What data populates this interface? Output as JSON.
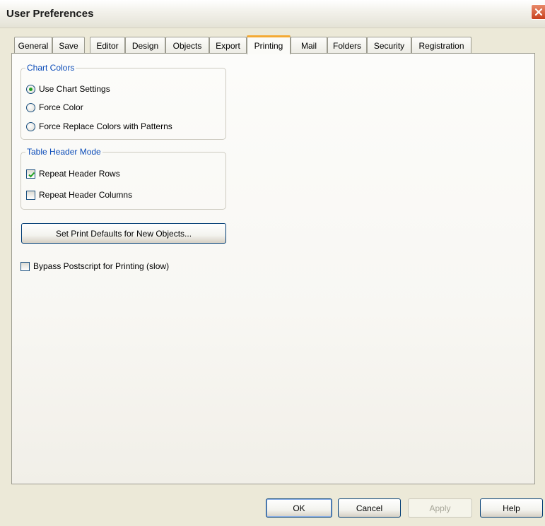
{
  "window": {
    "title": "User Preferences"
  },
  "tabs": [
    {
      "label": "General"
    },
    {
      "label": "Save"
    },
    {
      "label": "Editor"
    },
    {
      "label": "Design"
    },
    {
      "label": "Objects"
    },
    {
      "label": "Export"
    },
    {
      "label": "Printing",
      "active": true
    },
    {
      "label": "Mail"
    },
    {
      "label": "Folders"
    },
    {
      "label": "Security"
    },
    {
      "label": "Registration"
    }
  ],
  "chart_colors": {
    "legend": "Chart Colors",
    "options": [
      {
        "label": "Use Chart Settings",
        "selected": true
      },
      {
        "label": "Force Color",
        "selected": false
      },
      {
        "label": "Force Replace Colors with Patterns",
        "selected": false
      }
    ]
  },
  "table_header_mode": {
    "legend": "Table Header Mode",
    "options": [
      {
        "label": "Repeat Header Rows",
        "checked": true
      },
      {
        "label": "Repeat Header Columns",
        "checked": false
      }
    ]
  },
  "print_defaults_button": "Set Print Defaults for New Objects...",
  "bypass_postscript": {
    "label": "Bypass Postscript for Printing (slow)",
    "checked": false
  },
  "buttons": {
    "ok": "OK",
    "cancel": "Cancel",
    "apply": "Apply",
    "help": "Help"
  },
  "colors": {
    "accent_tab": "#f4a933",
    "group_legend": "#0a4bb8",
    "radio_dot": "#21a121",
    "check_mark": "#21a121"
  }
}
